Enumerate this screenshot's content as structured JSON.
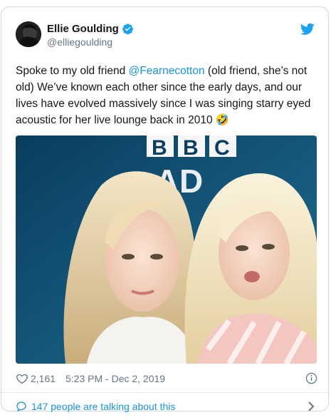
{
  "author": {
    "name": "Ellie Goulding",
    "handle": "@elliegoulding",
    "verified": true
  },
  "tweet": {
    "text_before": "Spoke to my old friend ",
    "mention": "@Fearnecotton",
    "text_after": " (old friend, she’s not old) We’ve known each other since the early days, and our lives have evolved massively since I was singing starry eyed acoustic for her live lounge back in 2010 🤣",
    "photo_sign_text": "BBC RAD"
  },
  "footer": {
    "like_count": "2,161",
    "timestamp": "5:23 PM - Dec 2, 2019"
  },
  "conversation": {
    "label": "147 people are talking about this"
  },
  "colors": {
    "accent": "#1b95e0",
    "text": "#14171a",
    "muted": "#657786",
    "border": "#cfd9de"
  },
  "icons": [
    "twitter-bird-icon",
    "verified-badge-icon",
    "heart-icon",
    "info-icon",
    "speech-bubble-icon",
    "chevron-right-icon"
  ]
}
